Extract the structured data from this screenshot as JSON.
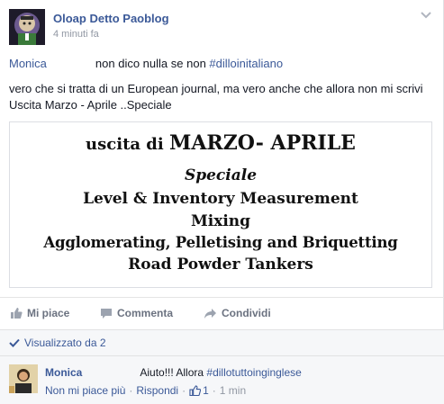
{
  "post": {
    "author": "Oloap Detto Paoblog",
    "time": "4 minuti fa",
    "mention": "Monica",
    "text1": "non dico nulla se non ",
    "hashtag1": "#dilloinitaliano",
    "text2": "vero che si tratta di un European journal, ma vero anche che allora non mi scrivi Uscita Marzo - Aprile ..Speciale"
  },
  "attachment": {
    "line1_prefix": "uscita di ",
    "line1_main": "MARZO- APRILE",
    "line2": "Speciale",
    "line3": "Level & Inventory Measurement",
    "line4": "Mixing",
    "line5": "Agglomerating, Pelletising and Briquetting",
    "line6": "Road Powder Tankers"
  },
  "actions": {
    "like": "Mi piace",
    "comment": "Commenta",
    "share": "Condividi"
  },
  "seen": {
    "label": "Visualizzato da 2"
  },
  "comment": {
    "author": "Monica",
    "text": "Aiuto!!! Allora ",
    "hashtag": "#dillotuttoinginglese",
    "unlike": "Non mi piace più",
    "reply": "Rispondi",
    "likes": "1",
    "time": "1 min"
  },
  "colors": {
    "link": "#3b5998",
    "meta": "#9197a3"
  }
}
